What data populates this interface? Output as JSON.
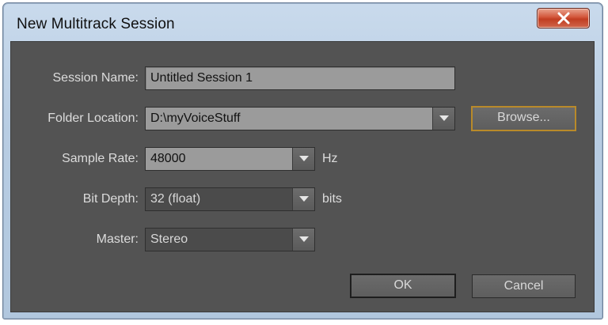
{
  "window": {
    "title": "New Multitrack Session",
    "close_glyph": "x"
  },
  "form": {
    "session_name_label": "Session Name:",
    "session_name_value": "Untitled Session 1",
    "folder_location_label": "Folder Location:",
    "folder_location_value": "D:\\myVoiceStuff",
    "browse_label": "Browse...",
    "sample_rate_label": "Sample Rate:",
    "sample_rate_value": "48000",
    "sample_rate_unit": "Hz",
    "bit_depth_label": "Bit Depth:",
    "bit_depth_value": "32 (float)",
    "bit_depth_unit": "bits",
    "master_label": "Master:",
    "master_value": "Stereo"
  },
  "buttons": {
    "ok_label": "OK",
    "cancel_label": "Cancel"
  },
  "icons": {
    "close": "close-icon",
    "dropdown": "chevron-down-icon"
  },
  "colors": {
    "dialog_background": "#535353",
    "field_background": "#9b9b9b",
    "browse_focus_border": "#b98a2a",
    "close_button": "#c94a30"
  }
}
